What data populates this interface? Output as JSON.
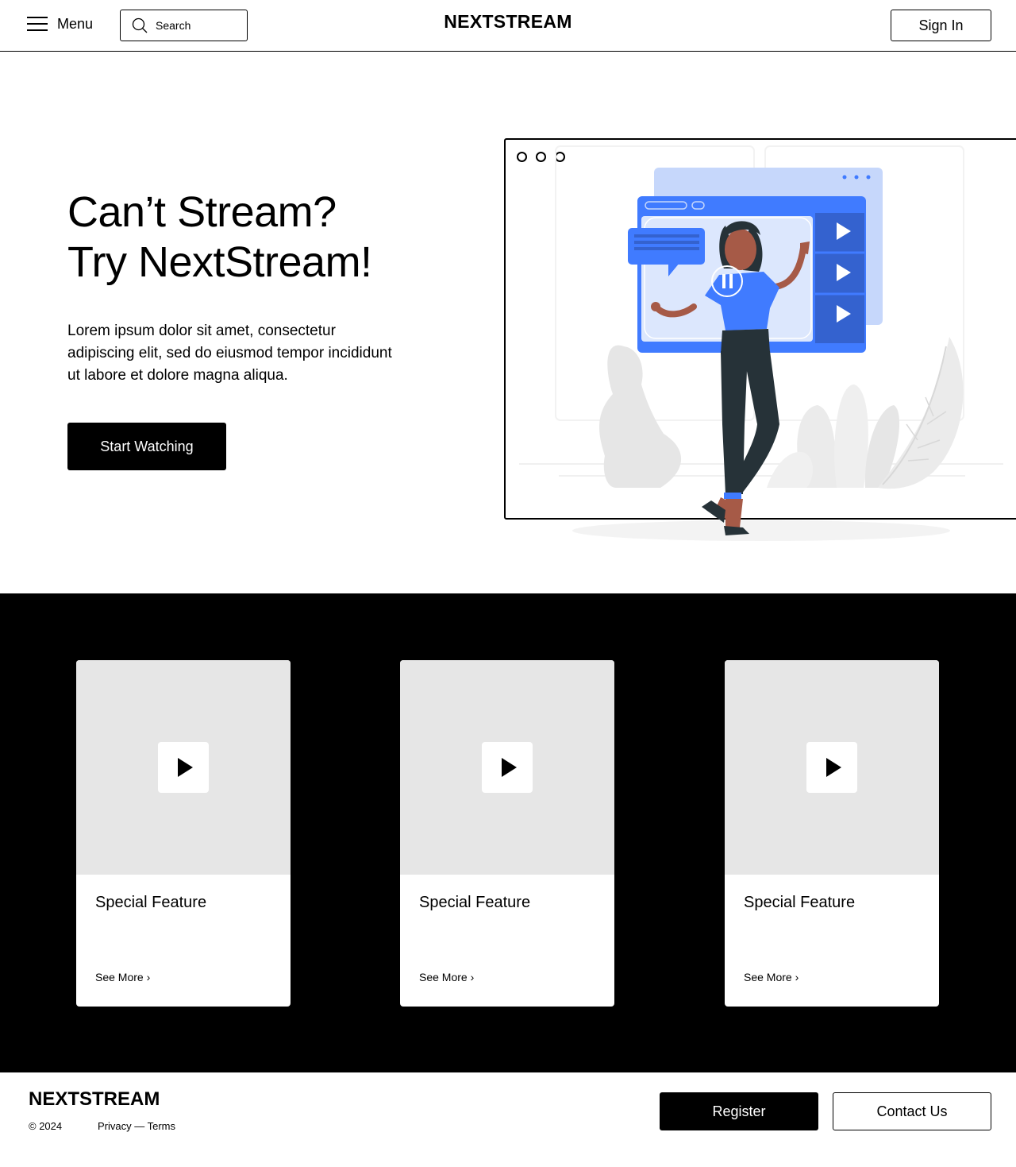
{
  "header": {
    "menu_label": "Menu",
    "search_placeholder": "Search",
    "brand": "NEXTSTREAM",
    "signin_label": "Sign In"
  },
  "hero": {
    "title_line1": "Can’t Stream?",
    "title_line2": "Try NextStream!",
    "description": "Lorem ipsum dolor sit amet, consectetur adipiscing elit, sed do eiusmod tempor incididunt ut labore et dolore magna aliqua.",
    "cta_label": "Start Watching",
    "illustration_icon": "video-streaming-illustration"
  },
  "features": {
    "cards": [
      {
        "title": "Special Feature",
        "link": "See More ›"
      },
      {
        "title": "Special Feature",
        "link": "See More ›"
      },
      {
        "title": "Special Feature",
        "link": "See More ›"
      }
    ]
  },
  "footer": {
    "brand": "NEXTSTREAM",
    "copyright": "© 2024",
    "links": "Privacy — Terms",
    "register_label": "Register",
    "contact_label": "Contact Us"
  },
  "colors": {
    "accent": "#407bff",
    "accent_light": "#c6d7fb",
    "accent_dark": "#3462cf",
    "placeholder_gray": "#e6e6e6"
  }
}
